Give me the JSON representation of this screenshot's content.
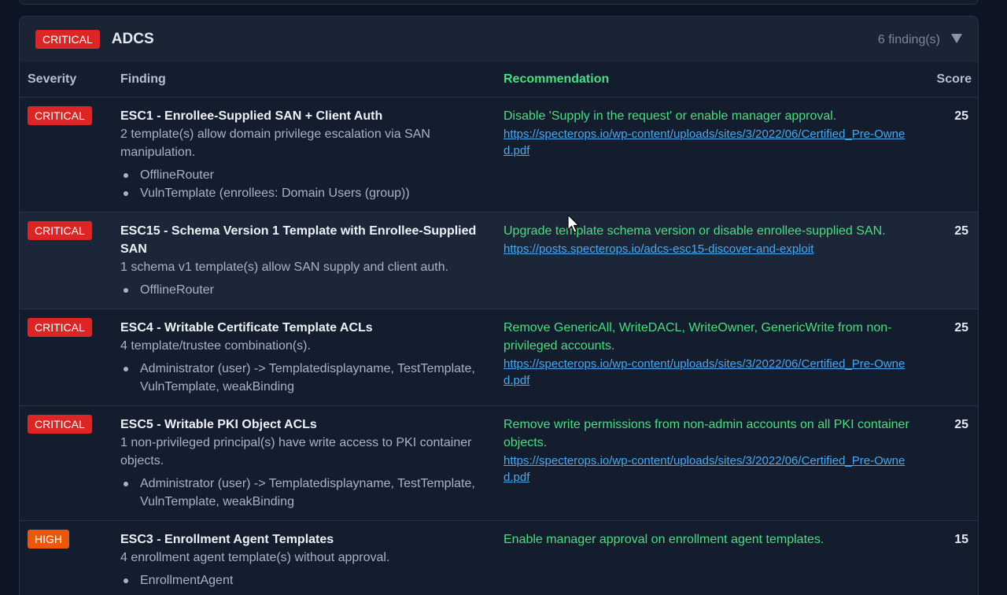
{
  "section": {
    "severity": "CRITICAL",
    "title": "ADCS",
    "count": "6 finding(s)"
  },
  "columns": {
    "severity": "Severity",
    "finding": "Finding",
    "recommendation": "Recommendation",
    "score": "Score"
  },
  "rows": [
    {
      "severity": "CRITICAL",
      "title": "ESC1 - Enrollee-Supplied SAN + Client Auth",
      "desc": "2 template(s) allow domain privilege escalation via SAN manipulation.",
      "items": [
        "OfflineRouter",
        "VulnTemplate (enrollees: Domain Users (group))"
      ],
      "rec": "Disable 'Supply in the request' or enable manager approval.",
      "link": "https://specterops.io/wp-content/uploads/sites/3/2022/06/Certified_Pre-Owned.pdf",
      "score": "25"
    },
    {
      "severity": "CRITICAL",
      "title": "ESC15 - Schema Version 1 Template with Enrollee-Supplied SAN",
      "desc": "1 schema v1 template(s) allow SAN supply and client auth.",
      "items": [
        "OfflineRouter"
      ],
      "rec": "Upgrade template schema version or disable enrollee-supplied SAN.",
      "link": "https://posts.specterops.io/adcs-esc15-discover-and-exploit",
      "score": "25"
    },
    {
      "severity": "CRITICAL",
      "title": "ESC4 - Writable Certificate Template ACLs",
      "desc": "4 template/trustee combination(s).",
      "items": [
        "Administrator (user) -> Templatedisplayname, TestTemplate, VulnTemplate, weakBinding"
      ],
      "rec": "Remove GenericAll, WriteDACL, WriteOwner, GenericWrite from non-privileged accounts.",
      "link": "https://specterops.io/wp-content/uploads/sites/3/2022/06/Certified_Pre-Owned.pdf",
      "score": "25"
    },
    {
      "severity": "CRITICAL",
      "title": "ESC5 - Writable PKI Object ACLs",
      "desc": "1 non-privileged principal(s) have write access to PKI container objects.",
      "items": [
        "Administrator (user) -> Templatedisplayname, TestTemplate, VulnTemplate, weakBinding"
      ],
      "rec": "Remove write permissions from non-admin accounts on all PKI container objects.",
      "link": "https://specterops.io/wp-content/uploads/sites/3/2022/06/Certified_Pre-Owned.pdf",
      "score": "25"
    },
    {
      "severity": "HIGH",
      "title": "ESC3 - Enrollment Agent Templates",
      "desc": "4 enrollment agent template(s) without approval.",
      "items": [
        "EnrollmentAgent"
      ],
      "rec": "Enable manager approval on enrollment agent templates.",
      "link": "",
      "score": "15"
    }
  ]
}
